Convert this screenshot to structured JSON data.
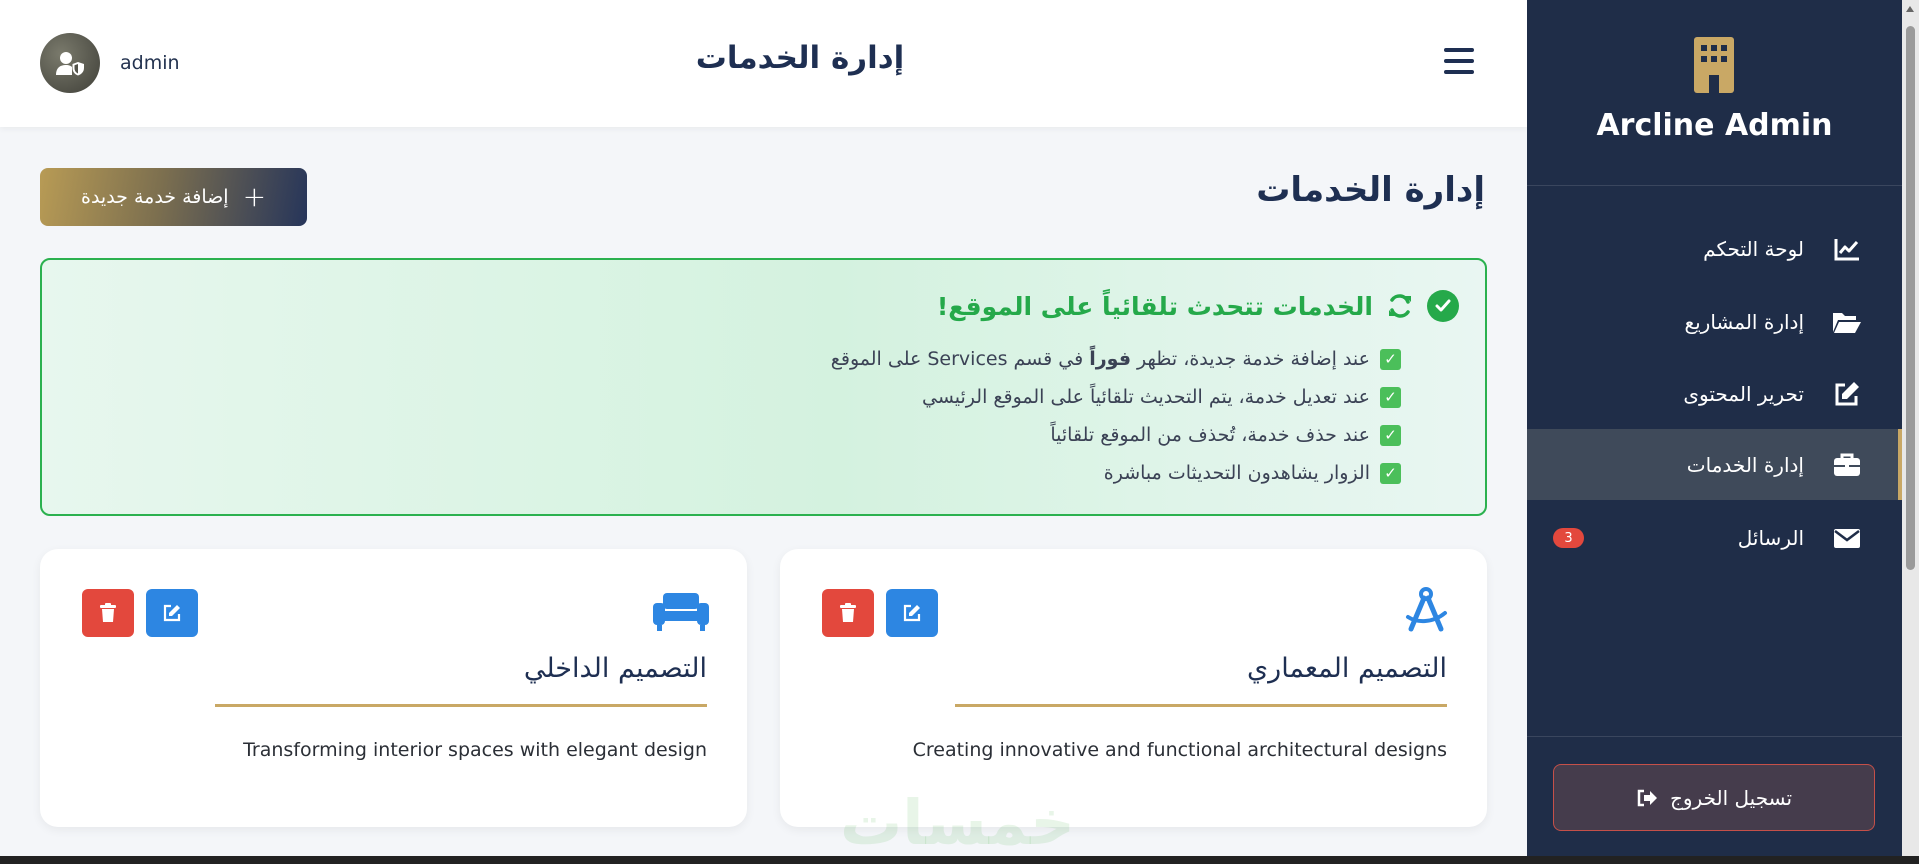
{
  "header": {
    "admin_name": "admin",
    "title": "إدارة الخدمات"
  },
  "page": {
    "title": "إدارة الخدمات",
    "add_button_label": "إضافة خدمة جديدة"
  },
  "notice": {
    "title": "الخدمات تتحدث تلقائياً على الموقع!",
    "items": [
      {
        "pre": "عند إضافة خدمة جديدة، تظهر ",
        "strong": "فوراً",
        "post": " في قسم Services على الموقع"
      },
      {
        "pre": "عند تعديل خدمة، يتم التحديث تلقائياً على الموقع الرئيسي",
        "strong": "",
        "post": ""
      },
      {
        "pre": "عند حذف خدمة، تُحذف من الموقع تلقائياً",
        "strong": "",
        "post": ""
      },
      {
        "pre": "الزوار يشاهدون التحديثات مباشرة",
        "strong": "",
        "post": ""
      }
    ]
  },
  "services": [
    {
      "title": "التصميم المعماري",
      "description": "Creating innovative and functional architectural designs",
      "icon": "drafting-compass-icon"
    },
    {
      "title": "التصميم الداخلي",
      "description": "Transforming interior spaces with elegant design",
      "icon": "couch-icon"
    }
  ],
  "sidebar": {
    "brand": "Arcline Admin",
    "items": [
      {
        "label": "لوحة التحكم",
        "icon": "chart-line-icon"
      },
      {
        "label": "إدارة المشاريع",
        "icon": "folder-open-icon"
      },
      {
        "label": "تحرير المحتوى",
        "icon": "edit-icon"
      },
      {
        "label": "إدارة الخدمات",
        "icon": "briefcase-icon",
        "active": true
      },
      {
        "label": "الرسائل",
        "icon": "envelope-icon",
        "badge": "3"
      }
    ],
    "logout_label": "تسجيل الخروج"
  },
  "watermark": "خمسات",
  "colors": {
    "sidebar_bg": "#1f2d48",
    "accent_gold": "#c9a865",
    "success_green": "#25a94a",
    "delete_red": "#e3483d",
    "edit_blue": "#2d86e2",
    "title_navy": "#1e2f52"
  }
}
